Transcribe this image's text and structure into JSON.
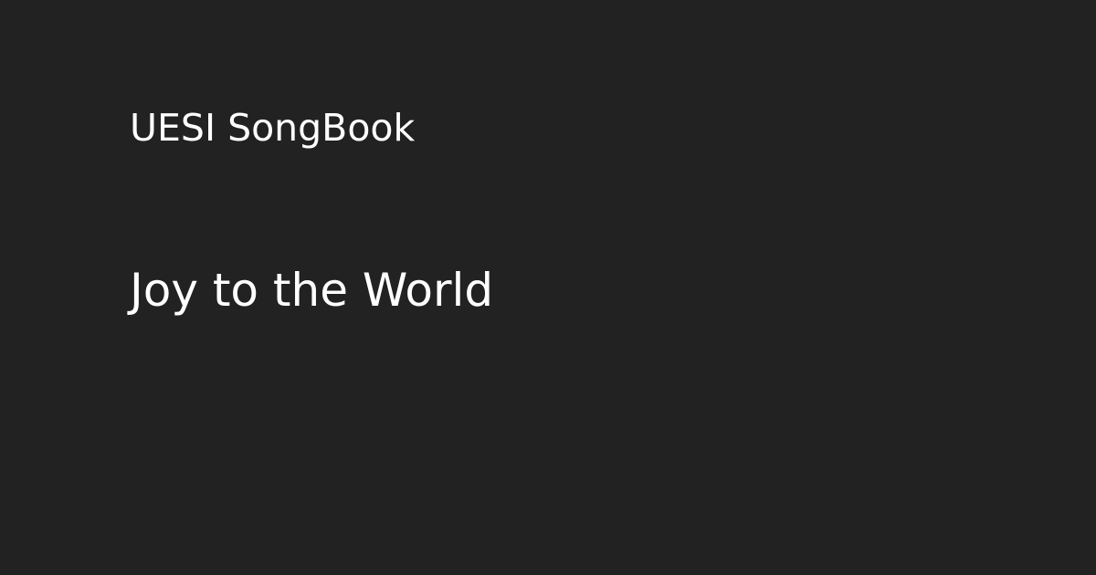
{
  "site": {
    "name": "UESI SongBook"
  },
  "song": {
    "title": "Joy to the World"
  },
  "colors": {
    "background": "#222222",
    "text": "#ffffff"
  }
}
